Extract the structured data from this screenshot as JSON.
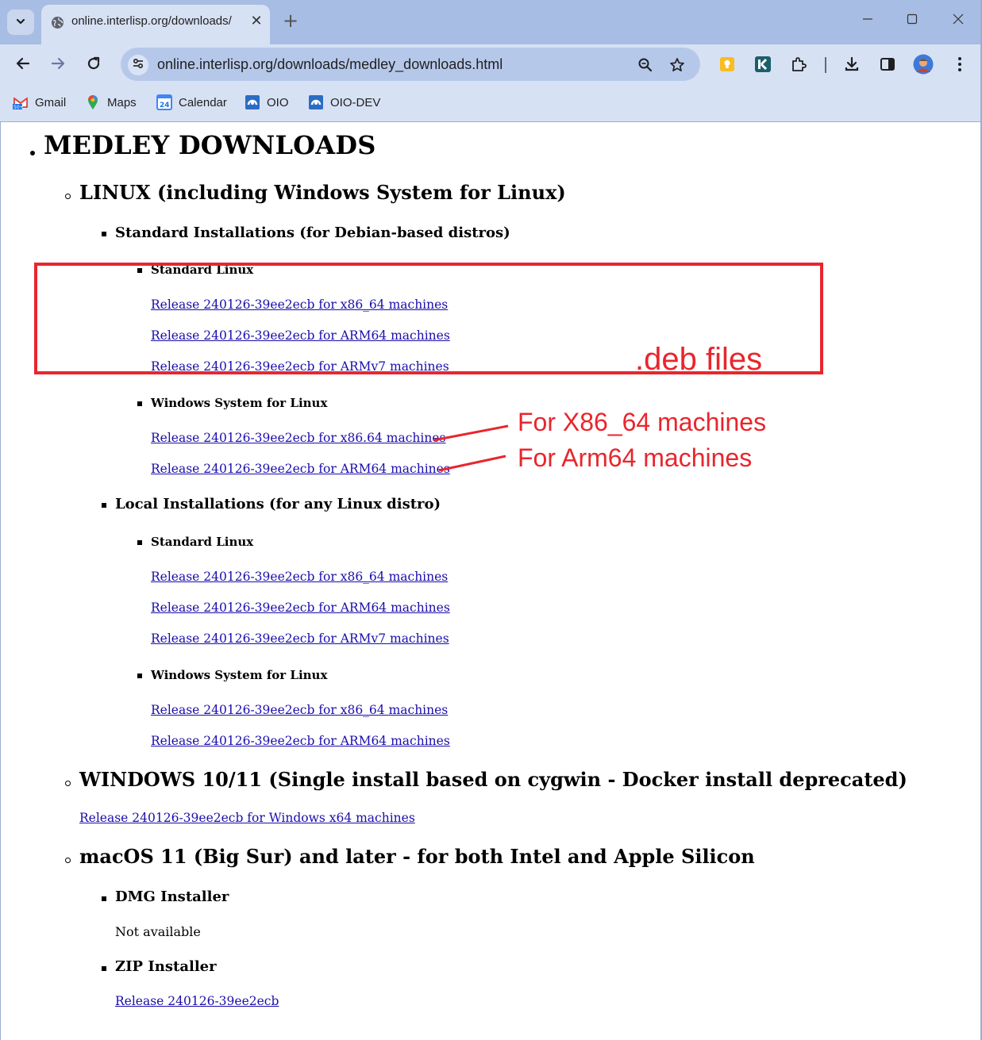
{
  "browser": {
    "tab": {
      "title": "online.interlisp.org/downloads/",
      "close": "✕"
    },
    "new_tab": "+",
    "address": "online.interlisp.org/downloads/medley_downloads.html",
    "bookmarks": [
      {
        "label": "Gmail",
        "icon": "gmail-icon"
      },
      {
        "label": "Maps",
        "icon": "maps-icon"
      },
      {
        "label": "Calendar",
        "icon": "calendar-icon",
        "badge": "24"
      },
      {
        "label": "OIO",
        "icon": "oio-icon"
      },
      {
        "label": "OIO-DEV",
        "icon": "oio-icon"
      }
    ],
    "colors": {
      "tabbar": "#a8bde3",
      "toolbar": "#d7e1f4",
      "omnibox": "#b6c8ea"
    }
  },
  "page": {
    "title": "MEDLEY DOWNLOADS",
    "linux": {
      "heading": "LINUX (including Windows System for Linux)",
      "standard": {
        "heading": "Standard Installations (for Debian-based distros)",
        "std_linux": {
          "heading": "Standard Linux",
          "links": [
            "Release 240126-39ee2ecb for x86_64 machines",
            "Release 240126-39ee2ecb for ARM64 machines",
            "Release 240126-39ee2ecb for ARMv7 machines"
          ]
        },
        "wsl": {
          "heading": "Windows System for Linux",
          "links": [
            "Release 240126-39ee2ecb for x86.64 machines",
            "Release 240126-39ee2ecb for ARM64 machines"
          ]
        }
      },
      "local": {
        "heading": "Local Installations (for any Linux distro)",
        "std_linux": {
          "heading": "Standard Linux",
          "links": [
            "Release 240126-39ee2ecb for x86_64 machines",
            "Release 240126-39ee2ecb for ARM64 machines",
            "Release 240126-39ee2ecb for ARMv7 machines"
          ]
        },
        "wsl": {
          "heading": "Windows System for Linux",
          "links": [
            "Release 240126-39ee2ecb for x86_64 machines",
            "Release 240126-39ee2ecb for ARM64 machines"
          ]
        }
      }
    },
    "windows": {
      "heading": "WINDOWS 10/11 (Single install based on cygwin - Docker install deprecated)",
      "link": "Release 240126-39ee2ecb for Windows x64 machines"
    },
    "macos": {
      "heading": "macOS 11 (Big Sur) and later - for both Intel and Apple Silicon",
      "dmg": {
        "heading": "DMG Installer",
        "text": "Not available"
      },
      "zip": {
        "heading": "ZIP Installer",
        "link": "Release 240126-39ee2ecb"
      }
    },
    "link_color": "#1a0dab"
  },
  "annotations": {
    "title": ".deb files",
    "label_x86": "For X86_64 machines",
    "label_arm": "For Arm64 machines",
    "color": "#e8262d"
  }
}
